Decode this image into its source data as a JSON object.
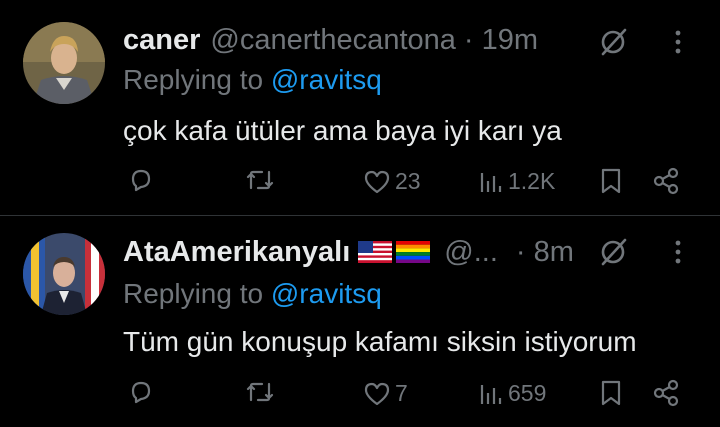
{
  "tweets": [
    {
      "name": "caner",
      "handle": "@canerthecantona",
      "dot": "·",
      "time": "19m",
      "replying_prefix": "Replying to",
      "replying_to": "@ravitsq",
      "text": "çok kafa ütüler ama baya iyi karı ya",
      "likes": "23",
      "views": "1.2K"
    },
    {
      "name": "AtaAmerikanyalı",
      "handle": "@...",
      "dot": "·",
      "time": "8m",
      "replying_prefix": "Replying to",
      "replying_to": "@ravitsq",
      "text": "Tüm gün konuşup kafamı siksin istiyorum",
      "likes": "7",
      "views": "659"
    }
  ],
  "icons": {
    "mute": "slashed-circle-icon",
    "more": "more-vertical-icon",
    "reply": "reply-icon",
    "retweet": "retweet-icon",
    "like": "heart-icon",
    "views": "views-bar-icon",
    "bookmark": "bookmark-icon",
    "share": "share-icon"
  },
  "colors": {
    "background": "#000000",
    "text": "#e7e9ea",
    "secondary": "#71767b",
    "accent": "#1d9bf0",
    "divider": "#2f3336"
  }
}
